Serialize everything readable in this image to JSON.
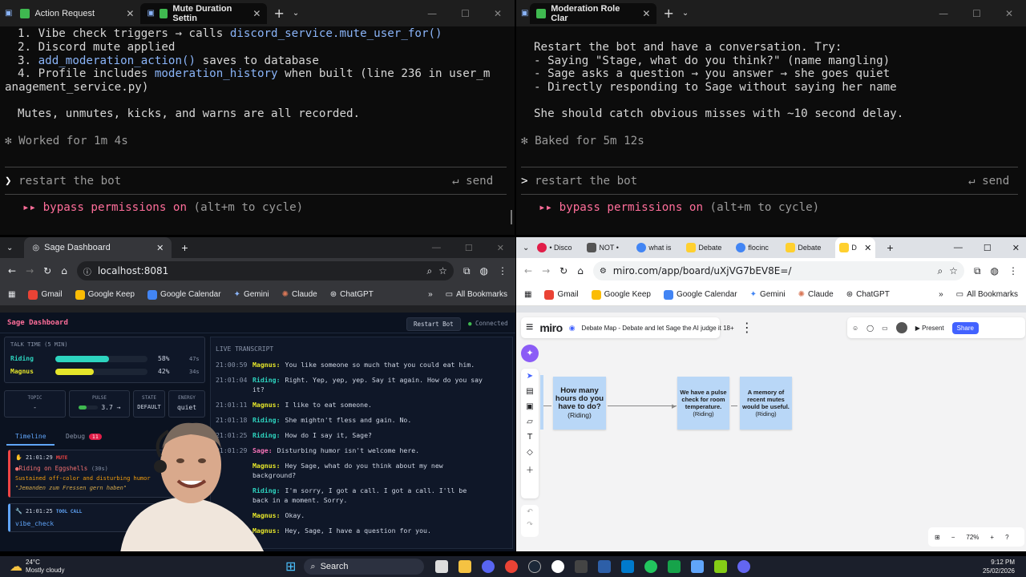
{
  "terminal_left": {
    "tabs": [
      {
        "label": "Action Request"
      },
      {
        "label": "Mute Duration Settin"
      }
    ],
    "lines": [
      {
        "num": "1.",
        "pre": " Vibe check triggers → calls ",
        "code": "discord_service.mute_user_for()",
        "post": ""
      },
      {
        "num": "2.",
        "pre": " Discord mute applied",
        "code": "",
        "post": ""
      },
      {
        "num": "3.",
        "pre": " ",
        "code": "add_moderation_action()",
        "post": " saves to database"
      },
      {
        "num": "4.",
        "pre": " Profile includes ",
        "code": "moderation_history",
        "post": " when built (line 236 in user_m"
      }
    ],
    "wrap": "anagement_service.py)",
    "summary": "Mutes, unmutes, kicks, and warns are all recorded.",
    "worked": "Worked for 1m 4s",
    "input": "restart the bot",
    "send": "↵ send",
    "bypass": "bypass permissions on",
    "bypass_hint": "(alt+m to cycle)"
  },
  "terminal_right": {
    "tabs": [
      {
        "label": "Moderation Role Clar"
      }
    ],
    "intro": "Restart the bot and have a conversation. Try:",
    "items": [
      "- Saying \"Stage, what do you think?\" (name mangling)",
      "- Sage asks a question → you answer → she goes quiet",
      "- Directly responding to Sage without saying her name"
    ],
    "catch": "She should catch obvious misses with ~10 second delay.",
    "baked": "Baked for 5m 12s",
    "input": "restart the bot",
    "send": "↵ send",
    "bypass": "bypass permissions on",
    "bypass_hint": "(alt+m to cycle)"
  },
  "browser_left": {
    "tab": "Sage Dashboard",
    "url": "localhost:8081",
    "bookmarks": [
      "Gmail",
      "Google Keep",
      "Google Calendar",
      "Gemini",
      "Claude",
      "ChatGPT"
    ],
    "all_bookmarks": "All Bookmarks",
    "dashboard": {
      "title": "Sage Dashboard",
      "restart": "Restart Bot",
      "status": "Connected",
      "talk_time": {
        "header": "TALK TIME (5 MIN)",
        "rows": [
          {
            "name": "Riding",
            "pct": "58%",
            "secs": "47s",
            "fill": 0.58,
            "color": "#2dd4bf"
          },
          {
            "name": "Magnus",
            "pct": "42%",
            "secs": "34s",
            "fill": 0.42,
            "color": "#e5e52a"
          }
        ]
      },
      "stats": [
        {
          "label": "TOPIC",
          "value": "-"
        },
        {
          "label": "PULSE",
          "value": "3.7 →"
        },
        {
          "label": "STATE",
          "value": "DEFAULT"
        },
        {
          "label": "ENERGY",
          "value": "quiet"
        }
      ],
      "tabs": {
        "timeline": "Timeline",
        "debug": "Debug",
        "debug_count": "11"
      },
      "events": [
        {
          "time": "21:01:29",
          "kind": "MUTE",
          "title": "Riding on Eggshells",
          "dur": "(30s)",
          "desc": "Sustained off-color and disturbing humor",
          "quote": "\"Jemanden zum Fressen gern haben\""
        },
        {
          "time": "21:01:25",
          "kind": "TOOL CALL",
          "title": "vibe_check"
        }
      ],
      "transcript_header": "LIVE TRANSCRIPT",
      "transcript": [
        {
          "time": "21:00:59",
          "who": "Magnus:",
          "text": "You like someone so much that you could eat him."
        },
        {
          "time": "21:01:04",
          "who": "Riding:",
          "text": "Right. Yep, yep, yep. Say it again. How do you say"
        },
        {
          "time": "",
          "who": "",
          "text": "it?"
        },
        {
          "time": "21:01:11",
          "who": "Magnus:",
          "text": "I like to eat someone."
        },
        {
          "time": "21:01:18",
          "who": "Riding:",
          "text": "She mightn't fless and gain. No."
        },
        {
          "time": "21:01:25",
          "who": "Riding:",
          "text": "How do I say it, Sage?"
        },
        {
          "time": "21:01:29",
          "who": "Sage:",
          "text": "Disturbing humor isn't welcome here."
        },
        {
          "time": "",
          "who": "Magnus:",
          "text": "Hey Sage, what do you think about my new"
        },
        {
          "time": "",
          "who": "",
          "text": "background?"
        },
        {
          "time": "",
          "who": "Riding:",
          "text": "I'm sorry, I got a call. I got a call. I'll be"
        },
        {
          "time": "",
          "who": "",
          "text": "back in a moment. Sorry."
        },
        {
          "time": "",
          "who": "Magnus:",
          "text": "Okay."
        },
        {
          "time": "",
          "who": "Magnus:",
          "text": "Hey, Sage, I have a question for you."
        }
      ]
    }
  },
  "browser_right": {
    "tabs": [
      "• Disco",
      "NOT •",
      "what is",
      "Debate",
      "flocinc",
      "Debate",
      "D"
    ],
    "url": "miro.com/app/board/uXjVG7bEV8E=/",
    "bookmarks": [
      "Gmail",
      "Google Keep",
      "Google Calendar",
      "Gemini",
      "Claude",
      "ChatGPT"
    ],
    "all_bookmarks": "All Bookmarks",
    "miro": {
      "logo": "miro",
      "board_title": "Debate Map - Debate and let Sage the AI judge it 18+",
      "present": "Present",
      "share": "Share",
      "zoom": "72%",
      "stickies": [
        {
          "text": "How many hours do you have to do?",
          "author": "(Riding)"
        },
        {
          "text": "We have a pulse check for room temperature.",
          "author": "(Riding)"
        },
        {
          "text": "A memory of recent mutes would be useful.",
          "author": "(Riding)"
        }
      ]
    }
  },
  "taskbar": {
    "temp": "24°C",
    "weather": "Mostly cloudy",
    "search": "Search",
    "time": "9:12 PM",
    "date": "25/02/2026"
  }
}
